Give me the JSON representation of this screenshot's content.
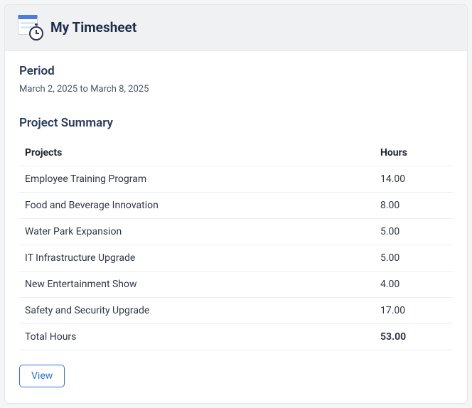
{
  "header": {
    "title": "My Timesheet"
  },
  "period": {
    "label": "Period",
    "range": "March 2, 2025 to March 8, 2025"
  },
  "summary": {
    "heading": "Project Summary",
    "col_project": "Projects",
    "col_hours": "Hours",
    "rows": [
      {
        "project": "Employee Training Program",
        "hours": "14.00"
      },
      {
        "project": "Food and Beverage Innovation",
        "hours": "8.00"
      },
      {
        "project": "Water Park Expansion",
        "hours": "5.00"
      },
      {
        "project": "IT Infrastructure Upgrade",
        "hours": "5.00"
      },
      {
        "project": "New Entertainment Show",
        "hours": "4.00"
      },
      {
        "project": "Safety and Security Upgrade",
        "hours": "17.00"
      }
    ],
    "total_label": "Total Hours",
    "total_value": "53.00"
  },
  "actions": {
    "view": "View"
  }
}
